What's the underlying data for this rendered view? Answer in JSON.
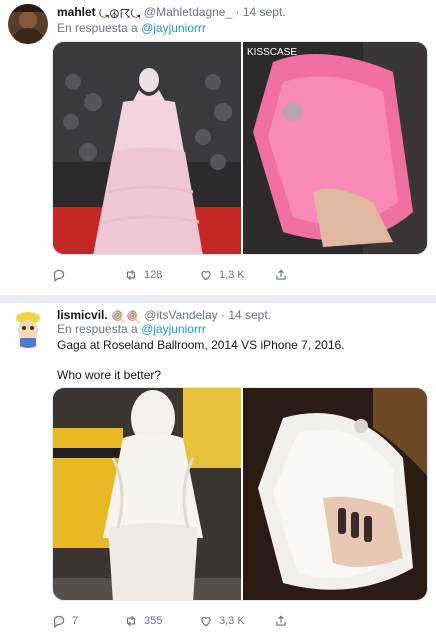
{
  "tweets": [
    {
      "name": "mahlet",
      "emoji_text": "⤿☮☈⤿",
      "handle": "@Mahletdagne_",
      "dot": "·",
      "time": "14 sept.",
      "reply_prefix": "En respuesta a",
      "reply_to": "@jayjuniorrr",
      "watermark": "KISSCASE",
      "actions": {
        "reply": "",
        "retweet": "128",
        "like": "1,3 K",
        "share": ""
      }
    },
    {
      "name": "lismicvil.",
      "emoji_text": "🍭🍭",
      "handle": "@itsVandelay",
      "dot": "·",
      "time": "14 sept.",
      "reply_prefix": "En respuesta a",
      "reply_to": "@jayjuniorrr",
      "text_line1": "Gaga at Roseland Ballroom, 2014 VS iPhone 7, 2016.",
      "text_line2": "Who wore it better?",
      "actions": {
        "reply": "7",
        "retweet": "355",
        "like": "3,3 K",
        "share": ""
      }
    }
  ],
  "colors": {
    "link": "#1b95e0",
    "muted": "#657786",
    "divider": "#e6ecf0"
  },
  "icons": [
    "reply-icon",
    "retweet-icon",
    "like-icon",
    "share-icon"
  ]
}
